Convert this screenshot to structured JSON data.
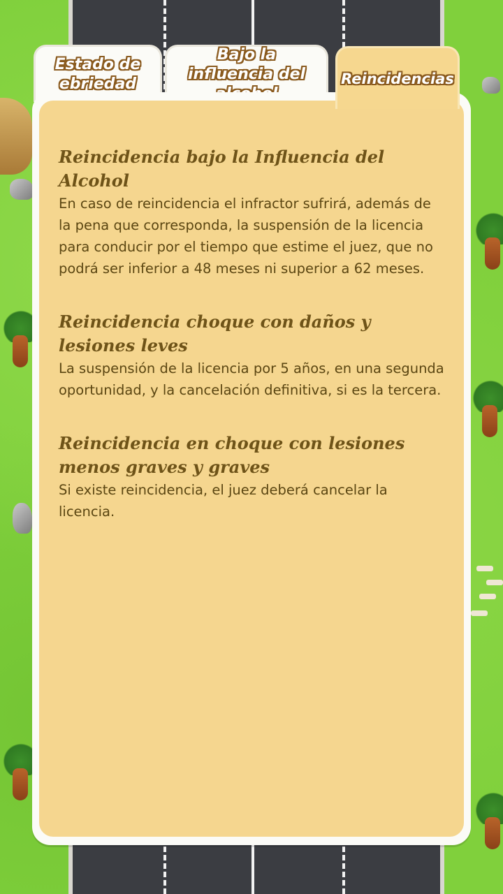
{
  "tabs": [
    {
      "label": "Estado de ebriedad",
      "active": false
    },
    {
      "label": "Bajo la influencia del alcohol",
      "active": false
    },
    {
      "label": "Reincidencias",
      "active": true
    }
  ],
  "sections": [
    {
      "title": "Reincidencia bajo la Influencia del Alcohol",
      "body": "En caso de reincidencia el infractor sufrirá, además de la pena que corresponda, la suspensión de la licencia para conducir por el tiempo que estime el juez, que no podrá ser inferior a 48 meses ni superior a 62 meses."
    },
    {
      "title": "Reincidencia choque con daños y lesiones leves",
      "body": "La suspensión de la licencia por 5 años, en una segunda oportunidad, y la cancelación definitiva, si es la tercera."
    },
    {
      "title": "Reincidencia en choque con lesiones menos graves y graves",
      "body": "Si existe reincidencia, el juez deberá cancelar la licencia."
    }
  ],
  "colors": {
    "panel": "#f5d68f",
    "tab_active": "#f6d78f",
    "tab_inactive": "#fbfbf7",
    "title_text": "#6e5318",
    "body_text": "#5b4612",
    "grass": "#80d03c",
    "road": "#3b3d42"
  }
}
